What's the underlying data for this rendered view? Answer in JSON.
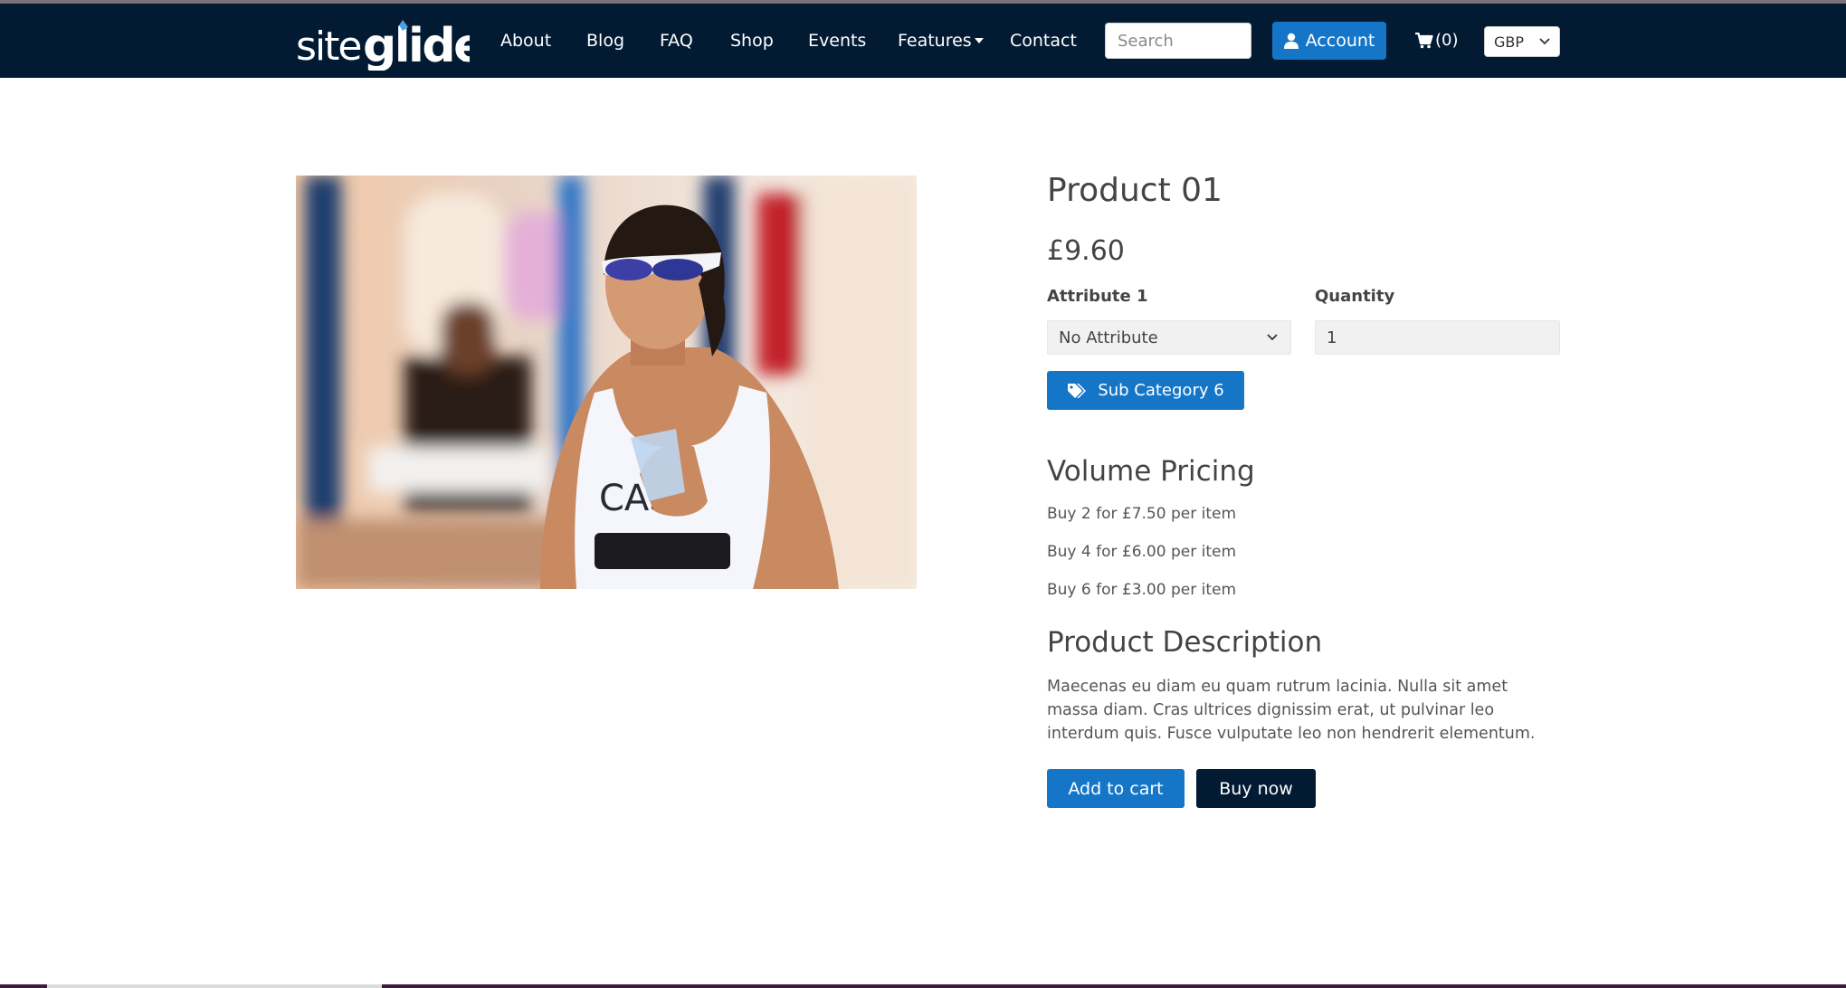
{
  "colors": {
    "navbar_bg": "#021b33",
    "primary_blue": "#1576c8",
    "dark_navy": "#021b33"
  },
  "header": {
    "logo": "siteglide.",
    "nav": [
      {
        "label": "About"
      },
      {
        "label": "Blog"
      },
      {
        "label": "FAQ"
      },
      {
        "label": "Shop"
      },
      {
        "label": "Events"
      },
      {
        "label": "Features"
      },
      {
        "label": "Contact"
      }
    ],
    "search": {
      "placeholder": "Search",
      "value": ""
    },
    "account_label": "Account",
    "cart_label": "(0)",
    "currency": "GBP",
    "icons": [
      "user-icon",
      "cart-icon",
      "chevron-down-icon"
    ]
  },
  "product": {
    "image_alt": "Runner wearing sunglasses and white racing vest",
    "title": "Product 01",
    "price": "£9.60",
    "attribute": {
      "label": "Attribute 1",
      "selected": "No Attribute"
    },
    "quantity": {
      "label": "Quantity",
      "value": "1"
    },
    "category_tag": "Sub Category 6",
    "volume_pricing": {
      "heading": "Volume Pricing",
      "items": [
        "Buy 2 for £7.50 per item",
        "Buy 4 for £6.00 per item",
        "Buy 6 for £3.00 per item"
      ]
    },
    "description": {
      "heading": "Product Description",
      "text": "Maecenas eu diam eu quam rutrum lacinia. Nulla sit amet massa diam. Cras ultrices dignissim erat, ut pulvinar leo interdum quis. Fusce vulputate leo non hendrerit elementum."
    },
    "add_to_cart_label": "Add to cart",
    "buy_now_label": "Buy now"
  }
}
